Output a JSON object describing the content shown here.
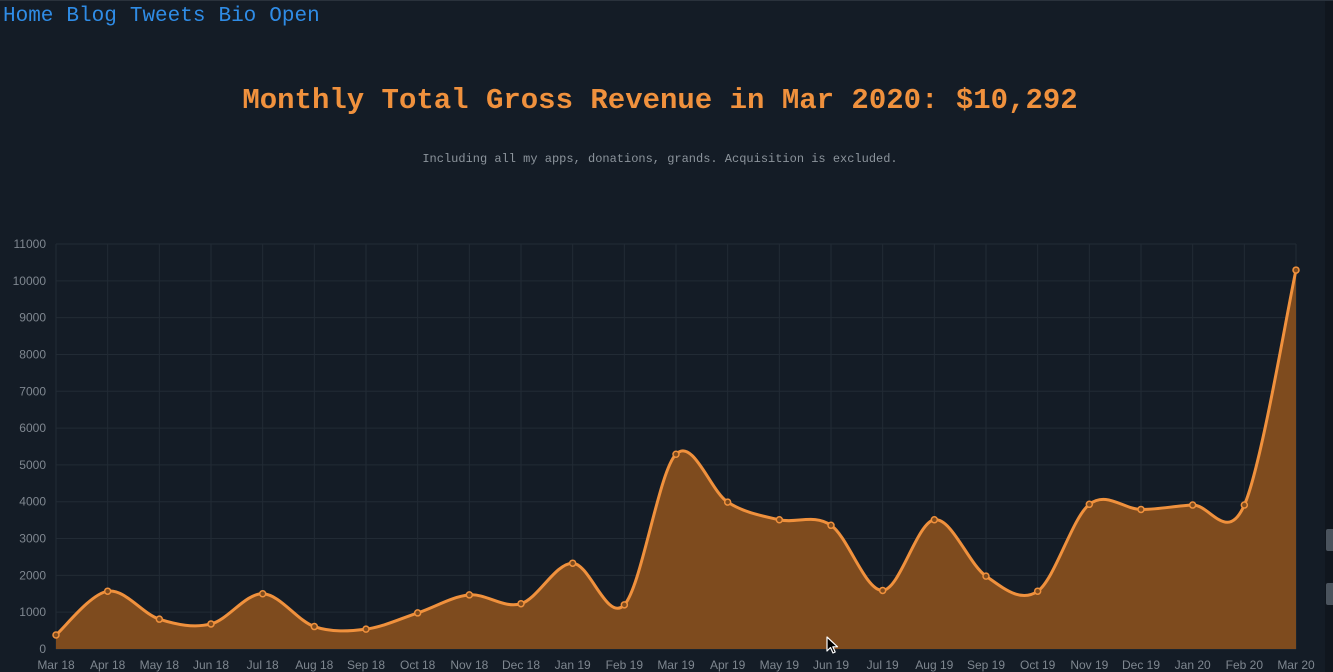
{
  "nav": {
    "items": [
      "Home",
      "Blog",
      "Tweets",
      "Bio",
      "Open"
    ]
  },
  "header": {
    "title": "Monthly Total Gross Revenue in Mar 2020: $10,292",
    "subtitle": "Including all my apps, donations, grands. Acquisition is excluded."
  },
  "colors": {
    "background": "#141c26",
    "accent": "#f0913d",
    "area_fill": "#7e4b1e",
    "link": "#2f8ce6",
    "grid": "#222b35",
    "tick_text": "#7f8790"
  },
  "chart_data": {
    "type": "area",
    "title": "",
    "xlabel": "",
    "ylabel": "",
    "ylim": [
      0,
      11000
    ],
    "yticks": [
      0,
      1000,
      2000,
      3000,
      4000,
      5000,
      6000,
      7000,
      8000,
      9000,
      10000,
      11000
    ],
    "grid": true,
    "legend": "none",
    "x": [
      "Mar 18",
      "Apr 18",
      "May 18",
      "Jun 18",
      "Jul 18",
      "Aug 18",
      "Sep 18",
      "Oct 18",
      "Nov 18",
      "Dec 18",
      "Jan 19",
      "Feb 19",
      "Mar 19",
      "Apr 19",
      "May 19",
      "Jun 19",
      "Jul 19",
      "Aug 19",
      "Sep 19",
      "Oct 19",
      "Nov 19",
      "Dec 19",
      "Jan 20",
      "Feb 20",
      "Mar 20"
    ],
    "series": [
      {
        "values": [
          380,
          1570,
          810,
          680,
          1500,
          610,
          540,
          980,
          1470,
          1230,
          2330,
          1200,
          5290,
          3990,
          3510,
          3360,
          1590,
          3510,
          1980,
          1570,
          3930,
          3790,
          3910,
          3910,
          10292
        ]
      }
    ]
  }
}
